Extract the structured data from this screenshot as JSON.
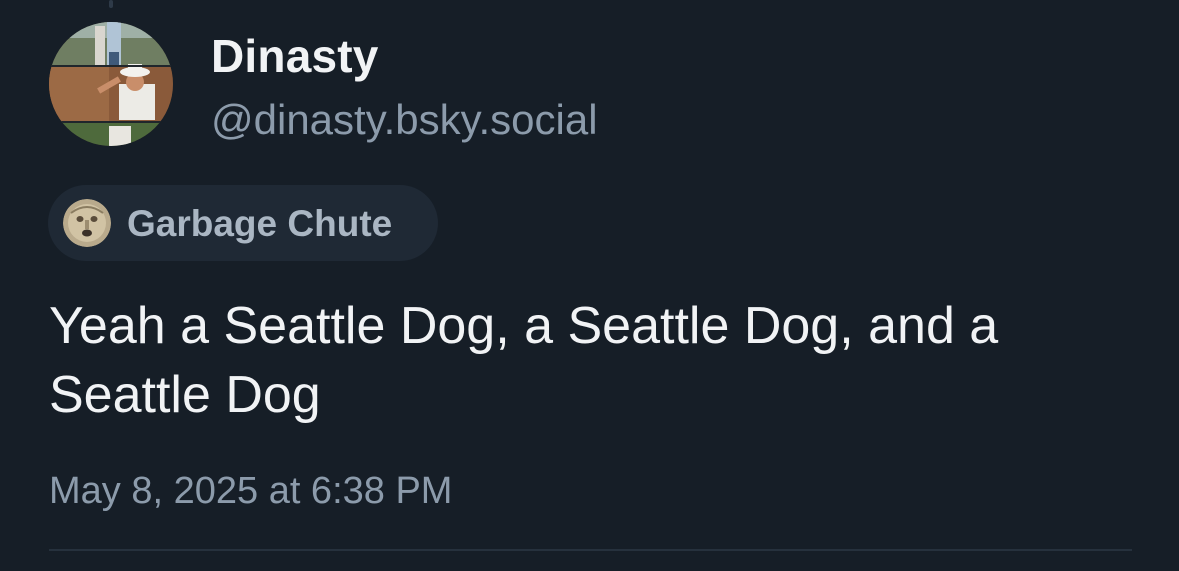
{
  "post": {
    "author": {
      "display_name": "Dinasty",
      "handle": "@dinasty.bsky.social"
    },
    "feed": {
      "name": "Garbage Chute"
    },
    "text": "Yeah a Seattle Dog, a Seattle Dog, and a Seattle Dog",
    "timestamp": "May 8, 2025 at 6:38 PM"
  },
  "colors": {
    "background": "#161e27",
    "text_primary": "#f1f3f5",
    "text_secondary": "#8c9bab",
    "chip_background": "#1f2935"
  },
  "icons": {
    "avatar": "user-avatar-photo-collage",
    "feed_icon": "stone-face-icon"
  }
}
